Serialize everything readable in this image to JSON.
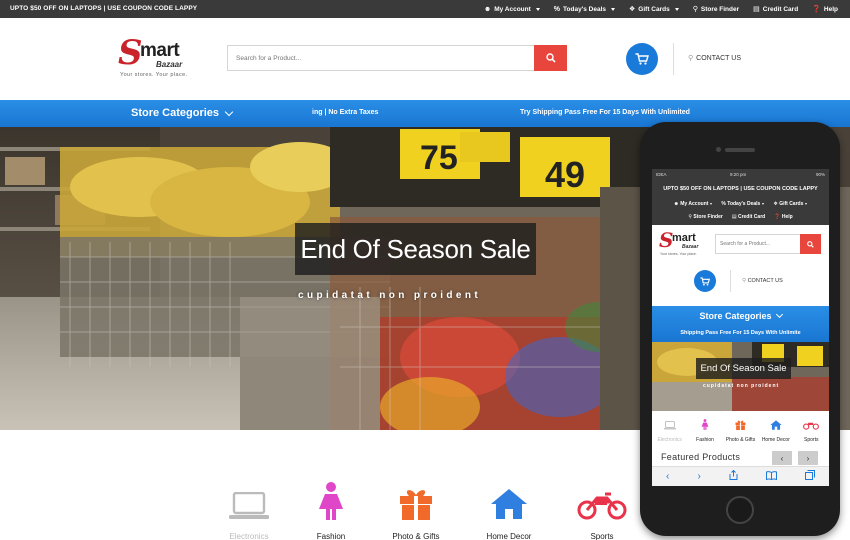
{
  "topbar": {
    "promo": "UPTO $50 OFF ON LAPTOPS | USE COUPON CODE LAPPY",
    "nav": [
      {
        "label": "My Account",
        "icon": "user-icon",
        "dropdown": true
      },
      {
        "label": "Today's Deals",
        "icon": "percent-icon",
        "dropdown": true
      },
      {
        "label": "Gift Cards",
        "icon": "gift-icon",
        "dropdown": true
      },
      {
        "label": "Store Finder",
        "icon": "map-pin-icon",
        "dropdown": false
      },
      {
        "label": "Credit Card",
        "icon": "credit-card-icon",
        "dropdown": false
      },
      {
        "label": "Help",
        "icon": "help-icon",
        "dropdown": false
      }
    ]
  },
  "header": {
    "logo": {
      "initial": "S",
      "word": "mart",
      "sub": "Bazaar",
      "tagline": "Your stores. Your place."
    },
    "search_placeholder": "Search for a Product...",
    "contact_label": "CONTACT US"
  },
  "navbar": {
    "categories_label": "Store Categories",
    "marquee_1": "ing | No Extra Taxes",
    "marquee_2": "Try Shipping Pass Free For 15 Days With Unlimited"
  },
  "hero": {
    "title": "End Of Season Sale",
    "subtitle": "cupidatat non proident"
  },
  "categories": [
    {
      "label": "Electronics",
      "icon": "laptop-icon",
      "color": "#bbbbbb",
      "active": false
    },
    {
      "label": "Fashion",
      "icon": "woman-icon",
      "color": "#e046c8",
      "active": true
    },
    {
      "label": "Photo & Gifts",
      "icon": "gift-box-icon",
      "color": "#f26a2a",
      "active": true
    },
    {
      "label": "Home Decor",
      "icon": "house-icon",
      "color": "#2f7fe0",
      "active": true
    },
    {
      "label": "Sports",
      "icon": "motorbike-icon",
      "color": "#e8334a",
      "active": true
    }
  ],
  "mobile": {
    "status": {
      "carrier": "IDEA",
      "time": "9:20 pm",
      "battery": "90%"
    },
    "promo": "UPTO $50 OFF ON LAPTOPS | USE COUPON CODE LAPPY",
    "nav_row1": [
      "My Account",
      "Today's Deals",
      "Gift Cards"
    ],
    "nav_row2": [
      "Store Finder",
      "Credit Card",
      "Help"
    ],
    "search_placeholder": "Search for a Product...",
    "contact_label": "CONTACT US",
    "categories_label": "Store Categories",
    "marquee": "Shipping Pass Free For 15 Days With Unlimite",
    "hero_title": "End Of Season Sale",
    "hero_subtitle": "cupidatat non proident",
    "categories": [
      "Electronics",
      "Fashion",
      "Photo & Gifts",
      "Home Decor",
      "Sports"
    ],
    "featured_title": "Featured Products",
    "prev": "‹",
    "next": "›"
  },
  "colors": {
    "accent_blue": "#1976d2",
    "search_red": "#e8453c",
    "topbar_bg": "#3a3a3a"
  }
}
